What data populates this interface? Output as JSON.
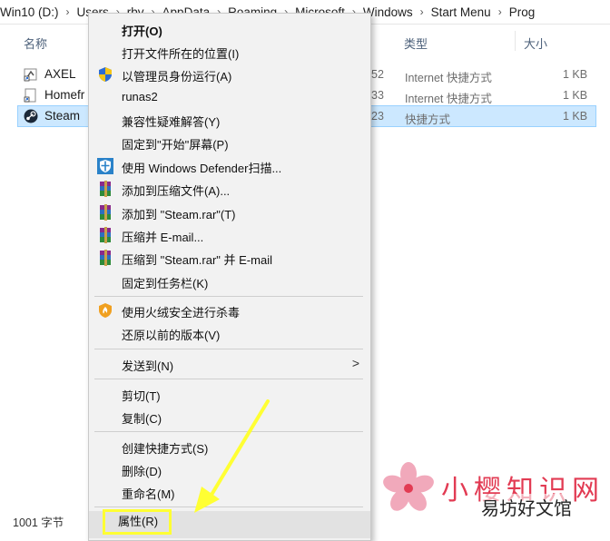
{
  "address_bar": {
    "crumbs": [
      "Win10 (D:)",
      "Users",
      "rby",
      "AppData",
      "Roaming",
      "Microsoft",
      "Windows",
      "Start Menu",
      "Prog"
    ],
    "separator": "›"
  },
  "columns": {
    "name": "名称",
    "type": "类型",
    "size": "大小"
  },
  "files": [
    {
      "name": "AXEL",
      "date_tail": "52",
      "type": "Internet 快捷方式",
      "size": "1 KB",
      "icon": "internet-shortcut-icon",
      "selected": false
    },
    {
      "name": "Homefr",
      "date_tail": "33",
      "type": "Internet 快捷方式",
      "size": "1 KB",
      "icon": "internet-shortcut-icon",
      "selected": false
    },
    {
      "name": "Steam",
      "date_tail": "23",
      "type": "快捷方式",
      "size": "1 KB",
      "icon": "steam-icon",
      "selected": true
    }
  ],
  "status_bar": {
    "size_text": "1001 字节"
  },
  "context_menu": {
    "items": [
      {
        "label": "打开(O)",
        "bold": true,
        "icon": ""
      },
      {
        "label": "打开文件所在的位置(I)",
        "icon": ""
      },
      {
        "label": "以管理员身份运行(A)",
        "icon": "uac-shield-icon"
      },
      {
        "label": "runas2",
        "icon": ""
      },
      {
        "label": "兼容性疑难解答(Y)",
        "icon": ""
      },
      {
        "label": "固定到\"开始\"屏幕(P)",
        "icon": ""
      },
      {
        "label": "使用 Windows Defender扫描...",
        "icon": "defender-shield-icon"
      },
      {
        "label": "添加到压缩文件(A)...",
        "icon": "winrar-icon"
      },
      {
        "label": "添加到 \"Steam.rar\"(T)",
        "icon": "winrar-icon"
      },
      {
        "label": "压缩并 E-mail...",
        "icon": "winrar-icon"
      },
      {
        "label": "压缩到 \"Steam.rar\" 并 E-mail",
        "icon": "winrar-icon"
      },
      {
        "label": "固定到任务栏(K)",
        "icon": ""
      },
      {
        "label": "使用火绒安全进行杀毒",
        "icon": "huorong-icon"
      },
      {
        "label": "还原以前的版本(V)",
        "icon": ""
      },
      {
        "label": "发送到(N)",
        "icon": "",
        "submenu": true
      },
      {
        "label": "剪切(T)",
        "icon": ""
      },
      {
        "label": "复制(C)",
        "icon": ""
      },
      {
        "label": "创建快捷方式(S)",
        "icon": ""
      },
      {
        "label": "删除(D)",
        "icon": ""
      },
      {
        "label": "重命名(M)",
        "icon": ""
      },
      {
        "label": "属性(R)",
        "icon": "",
        "highlighted": true
      }
    ],
    "submenu_arrow": ">"
  },
  "watermark": {
    "line1": "小樱知识网",
    "line2": "易坊好文馆"
  },
  "colors": {
    "selection": "#cce8ff",
    "highlight_box": "#ffff33",
    "annotation_arrow": "#ffff33",
    "watermark_red": "#e23b53"
  }
}
